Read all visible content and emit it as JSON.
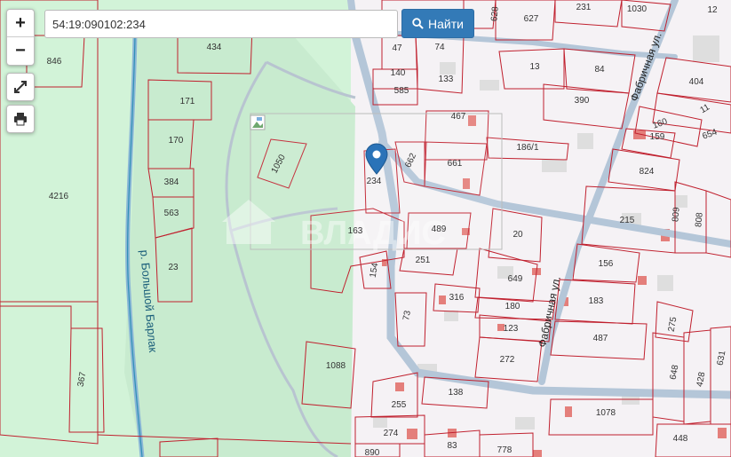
{
  "search": {
    "value": "54:19:090102:234",
    "button_label": "Найти",
    "button_icon": "search-icon"
  },
  "controls": {
    "zoom_in": "+",
    "zoom_out": "−",
    "fullscreen_icon": "fullscreen-icon",
    "print_icon": "print-icon"
  },
  "map": {
    "marker_label": "234",
    "streets": [
      "Фабричная ул.",
      "Фабричная ул."
    ],
    "river": "р. Большой Барлак",
    "plots": [
      "846",
      "434",
      "171",
      "170",
      "384",
      "563",
      "23",
      "1050",
      "4216",
      "367",
      "1088",
      "628",
      "627",
      "231",
      "1030",
      "12",
      "47",
      "74",
      "140",
      "585",
      "133",
      "13",
      "84",
      "404",
      "390",
      "11",
      "160",
      "654",
      "159",
      "467",
      "186/1",
      "662",
      "661",
      "824",
      "215",
      "809",
      "808",
      "163",
      "489",
      "20",
      "154",
      "251",
      "156",
      "649",
      "316",
      "183",
      "180",
      "73",
      "275",
      "123",
      "487",
      "272",
      "648",
      "428",
      "631",
      "138",
      "255",
      "1078",
      "274",
      "83",
      "778",
      "448",
      "890"
    ],
    "colors": {
      "greenery": "#d2f3d8",
      "road": "#b4c6d8",
      "boundary": "#c0202e",
      "building": "#dddddd",
      "building_accent": "#e47f7b",
      "marker": "#2a73b8",
      "button": "#337ab7"
    }
  }
}
